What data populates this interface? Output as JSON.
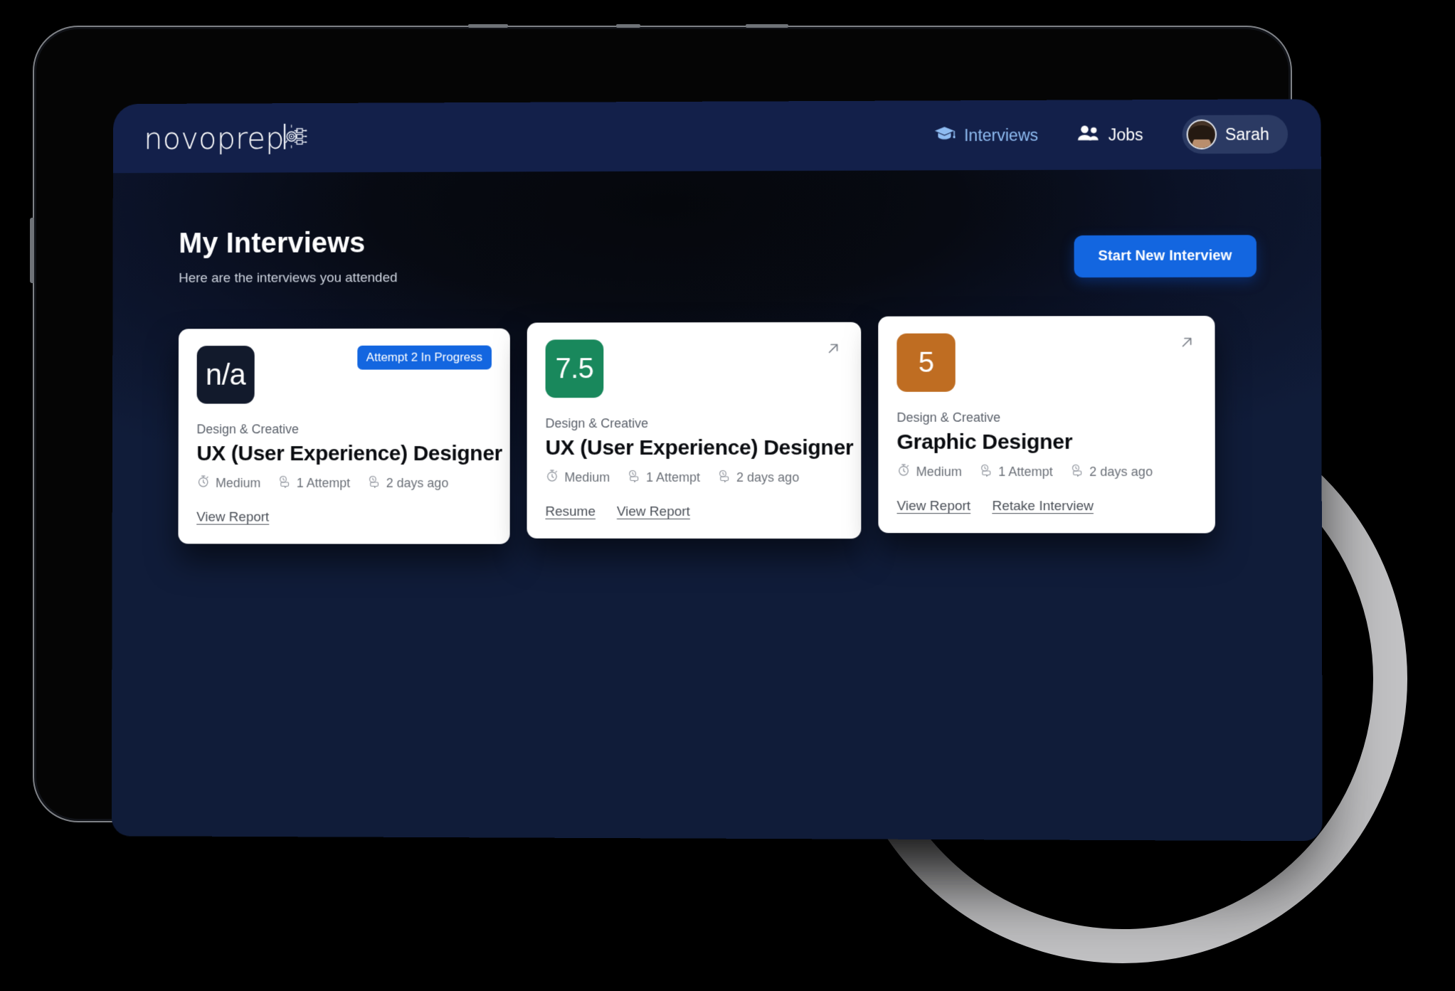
{
  "brand": {
    "name": "novoprep",
    "chip_icon": "ai-chip-icon"
  },
  "nav": {
    "interviews": {
      "label": "Interviews",
      "icon": "graduation-cap-icon"
    },
    "jobs": {
      "label": "Jobs",
      "icon": "people-icon"
    },
    "user": {
      "name": "Sarah",
      "icon": "avatar"
    }
  },
  "header": {
    "title": "My Interviews",
    "subtitle": "Here are the interviews you attended",
    "cta_label": "Start New Interview"
  },
  "colors": {
    "accent_blue": "#1366e0",
    "topbar_navy": "#13204a",
    "score_green": "#19885c",
    "score_orange": "#bf6d22",
    "score_dark": "#121a2c",
    "ring_gray": "#d2d3d5"
  },
  "cards": [
    {
      "score": "n/a",
      "score_style": "dark",
      "badge": "Attempt 2 In Progress",
      "has_arrow": false,
      "category": "Design & Creative",
      "title": "UX (User Experience) Designer",
      "meta": [
        {
          "icon": "stopwatch-icon",
          "text": "Medium"
        },
        {
          "icon": "attempts-icon",
          "text": "1 Attempt"
        },
        {
          "icon": "time-icon",
          "text": "2 days ago"
        }
      ],
      "links": [
        "View Report"
      ]
    },
    {
      "score": "7.5",
      "score_style": "green",
      "badge": null,
      "has_arrow": true,
      "category": "Design & Creative",
      "title": "UX (User Experience) Designer",
      "meta": [
        {
          "icon": "stopwatch-icon",
          "text": "Medium"
        },
        {
          "icon": "attempts-icon",
          "text": "1 Attempt"
        },
        {
          "icon": "time-icon",
          "text": "2 days ago"
        }
      ],
      "links": [
        "Resume",
        "View Report"
      ]
    },
    {
      "score": "5",
      "score_style": "orange",
      "badge": null,
      "has_arrow": true,
      "category": "Design & Creative",
      "title": "Graphic Designer",
      "meta": [
        {
          "icon": "stopwatch-icon",
          "text": "Medium"
        },
        {
          "icon": "attempts-icon",
          "text": "1 Attempt"
        },
        {
          "icon": "time-icon",
          "text": "2 days ago"
        }
      ],
      "links": [
        "View Report",
        "Retake Interview"
      ]
    }
  ]
}
